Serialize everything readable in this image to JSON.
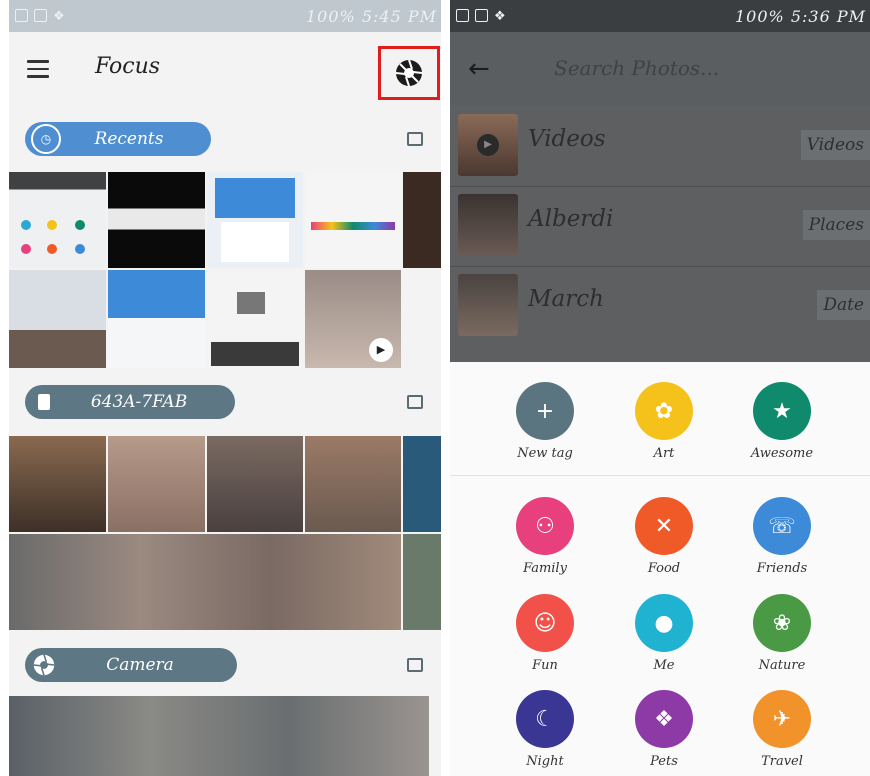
{
  "left": {
    "status": {
      "time": "100% 5:45 PM"
    },
    "app_title": "Focus",
    "sections": [
      {
        "label": "Recents",
        "icon": "timer-icon"
      },
      {
        "label": "643A-7FAB",
        "icon": "sd-card-icon"
      },
      {
        "label": "Camera",
        "icon": "shutter-icon"
      }
    ]
  },
  "right": {
    "status": {
      "time": "100% 5:36 PM"
    },
    "search_placeholder": "Search Photos...",
    "results": [
      {
        "label": "Videos",
        "chip": "Videos"
      },
      {
        "label": "Alberdi",
        "chip": "Places"
      },
      {
        "label": "March",
        "chip": "Date"
      }
    ],
    "tags": [
      {
        "label": "New tag",
        "color": "#5a7480",
        "icon": "plus-icon",
        "glyph": "+"
      },
      {
        "label": "Art",
        "color": "#f5c21b",
        "icon": "palette-icon",
        "glyph": "✿"
      },
      {
        "label": "Awesome",
        "color": "#0f8a6c",
        "icon": "star-icon",
        "glyph": "★"
      },
      {
        "label": "Family",
        "color": "#e7407d",
        "icon": "people-icon",
        "glyph": "⚇"
      },
      {
        "label": "Food",
        "color": "#f05a28",
        "icon": "fork-knife-icon",
        "glyph": "✕"
      },
      {
        "label": "Friends",
        "color": "#3d8ad8",
        "icon": "phone-person-icon",
        "glyph": "☏"
      },
      {
        "label": "Fun",
        "color": "#f2514a",
        "icon": "smiley-icon",
        "glyph": "☺"
      },
      {
        "label": "Me",
        "color": "#1fb3d1",
        "icon": "person-icon",
        "glyph": "●"
      },
      {
        "label": "Nature",
        "color": "#4a9a45",
        "icon": "flower-icon",
        "glyph": "❀"
      },
      {
        "label": "Night",
        "color": "#3a3693",
        "icon": "moon-icon",
        "glyph": "☾"
      },
      {
        "label": "Pets",
        "color": "#8e3aa6",
        "icon": "paw-icon",
        "glyph": "❖"
      },
      {
        "label": "Travel",
        "color": "#f2922b",
        "icon": "airplane-icon",
        "glyph": "✈"
      }
    ]
  }
}
